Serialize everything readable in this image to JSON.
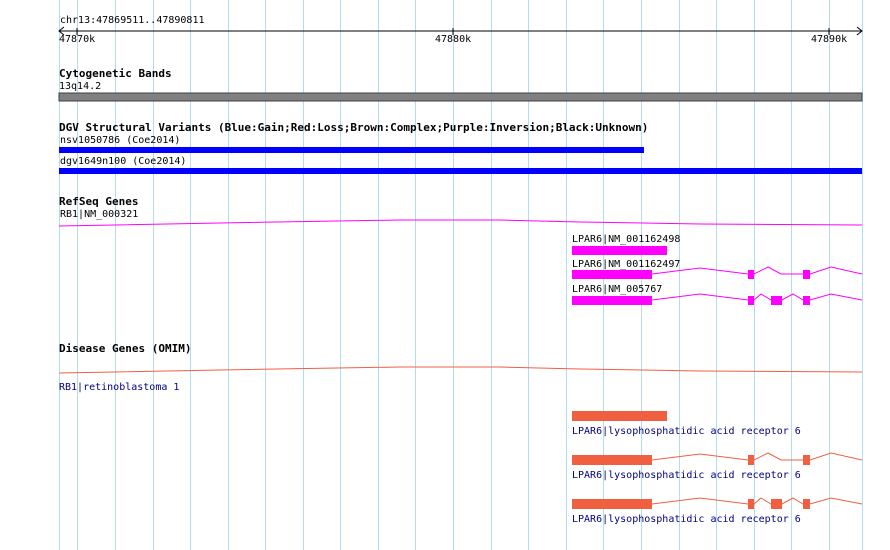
{
  "ruler": {
    "region": "chr13:47869511..47890811",
    "ticks": [
      "47870k",
      "47880k",
      "47890k"
    ]
  },
  "tracks": {
    "cytoband": {
      "title": "Cytogenetic Bands",
      "band_label": "13q14.2",
      "band_color": "#808080"
    },
    "dgv": {
      "title": "DGV Structural Variants (Blue:Gain;Red:Loss;Brown:Complex;Purple:Inversion;Black:Unknown)",
      "color": "#0000ff",
      "features": [
        {
          "label": "nsv1050786 (Coe2014)"
        },
        {
          "label": "dgv1649n100 (Coe2014)"
        }
      ]
    },
    "refseq": {
      "title": "RefSeq Genes",
      "color": "#ff00ff",
      "features": [
        {
          "label": "RB1|NM_000321"
        },
        {
          "label": "LPAR6|NM_001162498"
        },
        {
          "label": "LPAR6|NM_001162497"
        },
        {
          "label": "LPAR6|NM_005767"
        }
      ]
    },
    "omim": {
      "title": "Disease Genes (OMIM)",
      "color": "#f06040",
      "features": [
        {
          "label": "RB1|retinoblastoma 1"
        },
        {
          "label": "LPAR6|lysophosphatidic acid receptor 6"
        },
        {
          "label": "LPAR6|lysophosphatidic acid receptor 6"
        },
        {
          "label": "LPAR6|lysophosphatidic acid receptor 6"
        }
      ]
    }
  },
  "colors": {
    "gridline": "#b4dcf0",
    "ruler": "#000000"
  }
}
